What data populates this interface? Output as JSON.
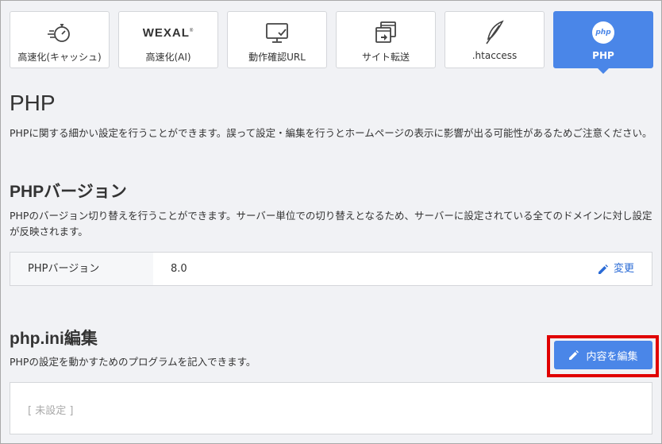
{
  "tabs": [
    {
      "label": "高速化(キャッシュ)",
      "icon": "stopwatch-icon"
    },
    {
      "label": "高速化(AI)",
      "icon": "wexal-logo",
      "logo_text": "WEXAL",
      "logo_mark": "®"
    },
    {
      "label": "動作確認URL",
      "icon": "monitor-check-icon"
    },
    {
      "label": "サイト転送",
      "icon": "windows-transfer-icon"
    },
    {
      "label": ".htaccess",
      "icon": "feather-icon"
    },
    {
      "label": "PHP",
      "icon": "php-icon",
      "badge_text": "php",
      "active": true
    }
  ],
  "page": {
    "title": "PHP",
    "description": "PHPに関する細かい設定を行うことができます。誤って設定・編集を行うとホームページの表示に影響が出る可能性があるためご注意ください。"
  },
  "php_version": {
    "title": "PHPバージョン",
    "description": "PHPのバージョン切り替えを行うことができます。サーバー単位での切り替えとなるため、サーバーに設定されている全てのドメインに対し設定が反映されます。",
    "label": "PHPバージョン",
    "value": "8.0",
    "change_label": "変更"
  },
  "php_ini": {
    "title": "php.ini編集",
    "description": "PHPの設定を動かすためのプログラムを記入できます。",
    "edit_button_label": "内容を編集",
    "placeholder": "[ 未設定 ]"
  },
  "colors": {
    "accent": "#4a86e8",
    "highlight": "#e00000",
    "link": "#2a6bd6"
  }
}
